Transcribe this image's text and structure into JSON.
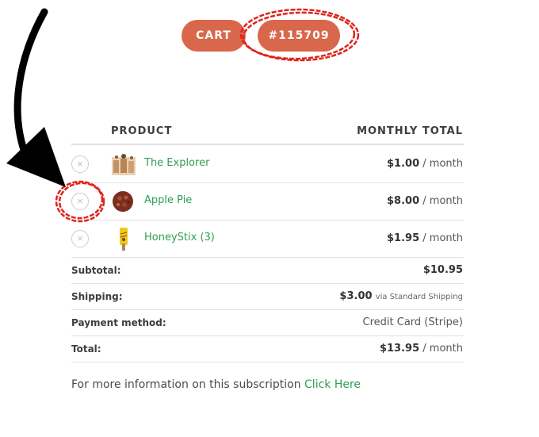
{
  "header": {
    "cart_label": "CART",
    "order_label": "#115709"
  },
  "table": {
    "headers": {
      "product": "PRODUCT",
      "total": "MONTHLY TOTAL"
    },
    "items": [
      {
        "name": "The Explorer",
        "price": "$1.00",
        "period": "/ month",
        "icon": "explorer-product-thumbnail"
      },
      {
        "name": "Apple Pie",
        "price": "$8.00",
        "period": "/ month",
        "icon": "apple-pie-product-thumbnail"
      },
      {
        "name": "HoneyStix (3)",
        "price": "$1.95",
        "period": "/ month",
        "icon": "honeystix-product-thumbnail"
      }
    ],
    "remove_glyph": "×"
  },
  "totals": {
    "subtotal_label": "Subtotal:",
    "subtotal_value": "$10.95",
    "shipping_label": "Shipping:",
    "shipping_value": "$3.00",
    "shipping_via": "via Standard Shipping",
    "payment_label": "Payment method:",
    "payment_value": "Credit Card (Stripe)",
    "total_label": "Total:",
    "total_value": "$13.95",
    "total_period": "/ month"
  },
  "footer": {
    "info_text": "For more information on this subscription",
    "link_text": "Click Here"
  },
  "colors": {
    "pill": "#d9674b",
    "link": "#2f9e4f",
    "annotation": "#e0231b"
  }
}
